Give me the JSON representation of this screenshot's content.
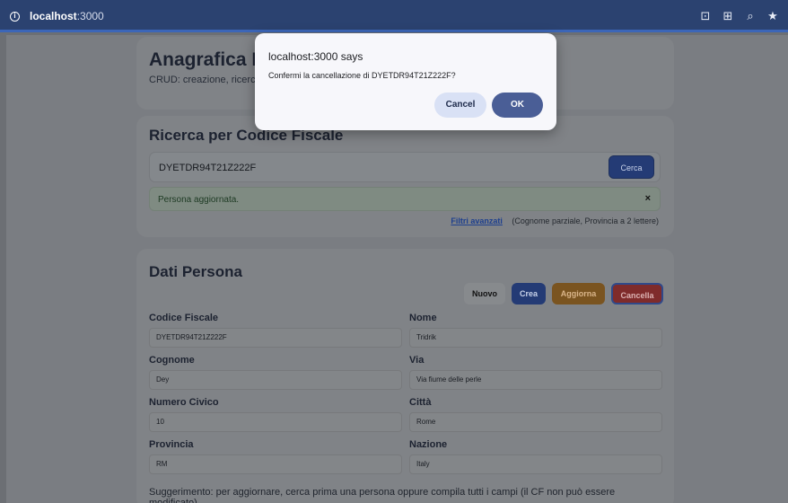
{
  "browser": {
    "url_host": "localhost",
    "url_port": ":3000",
    "icons": [
      "install-icon",
      "translate-icon",
      "zoom-icon",
      "bookmark-star-icon"
    ]
  },
  "header": {
    "title": "Anagrafica Pe",
    "subtitle": "CRUD: creazione, ricerc"
  },
  "search": {
    "heading": "Ricerca per Codice Fiscale",
    "value": "DYETDR94T21Z222F",
    "button_label": "Cerca",
    "alert_text": "Persona aggiornata.",
    "alert_close": "×",
    "advanced_link": "Filtri avanzati",
    "advanced_note": "(Cognome parziale, Provincia a 2 lettere)"
  },
  "person": {
    "heading": "Dati Persona",
    "buttons": {
      "nuovo": "Nuovo",
      "crea": "Crea",
      "aggiorna": "Aggiorna",
      "cancella": "Cancella"
    },
    "fields": {
      "codice_fiscale": {
        "label": "Codice Fiscale",
        "value": "DYETDR94T21Z222F"
      },
      "nome": {
        "label": "Nome",
        "value": "Tridrik"
      },
      "cognome": {
        "label": "Cognome",
        "value": "Dey"
      },
      "via": {
        "label": "Via",
        "value": "Via fiume delle perle"
      },
      "numero_civico": {
        "label": "Numero Civico",
        "value": "10"
      },
      "citta": {
        "label": "Città",
        "value": "Rome"
      },
      "provincia": {
        "label": "Provincia",
        "value": "RM"
      },
      "nazione": {
        "label": "Nazione",
        "value": "Italy"
      }
    },
    "hint": "Suggerimento: per aggiornare, cerca prima una persona oppure compila tutti i campi (il CF non può essere modificato)."
  },
  "dialog": {
    "title": "localhost:3000 says",
    "message": "Confermi la cancellazione di DYETDR94T21Z222F?",
    "cancel_label": "Cancel",
    "ok_label": "OK"
  },
  "colors": {
    "browser_bar": "#2b4270",
    "primary": "#243b75",
    "warning": "#7a5420",
    "danger": "#7f2b2b",
    "ok_button": "#4a5e96"
  }
}
